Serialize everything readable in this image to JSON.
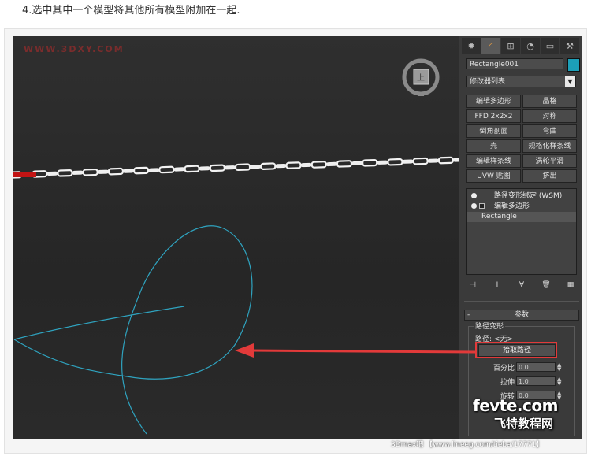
{
  "caption": "4.选中其中一个模型将其他所有模型附加在一起.",
  "viewport": {
    "watermark": "WWW.3DXY.COM",
    "viewcube_label": "上"
  },
  "panel": {
    "tabs": [
      {
        "icon": "create-icon"
      },
      {
        "icon": "modify-icon"
      },
      {
        "icon": "hierarchy-icon"
      },
      {
        "icon": "motion-icon"
      },
      {
        "icon": "display-icon"
      },
      {
        "icon": "utilities-icon"
      }
    ],
    "object_name": "Rectangle001",
    "object_color": "#1c9fb8",
    "modifier_list": "修改器列表",
    "modifier_buttons": [
      "编辑多边形",
      "晶格",
      "FFD 2x2x2",
      "对称",
      "倒角剖面",
      "弯曲",
      "壳",
      "规格化样条线",
      "编辑样条线",
      "涡轮平滑",
      "UVW 贴图",
      "挤出"
    ],
    "stack": [
      "路径变形绑定 (WSM)",
      "编辑多边形",
      "Rectangle"
    ],
    "params": {
      "rollout_title": "参数",
      "rollout_toggle": "-",
      "group_title": "路径变形",
      "path_label": "路径:",
      "path_value": "<无>",
      "pick_path_button": "拾取路径",
      "fields": [
        {
          "label": "百分比",
          "value": "0.0"
        },
        {
          "label": "拉伸",
          "value": "1.0"
        },
        {
          "label": "旋转",
          "value": "0.0"
        }
      ]
    }
  },
  "watermarks": {
    "fevte": "fevte.com",
    "fevte_cn": "飞特教程网",
    "bottom": "3Dmax吧 【www.lineeg.com/tieba/17771】"
  },
  "colors": {
    "highlight": "#e23a3a",
    "spline": "#2fa3bf"
  }
}
